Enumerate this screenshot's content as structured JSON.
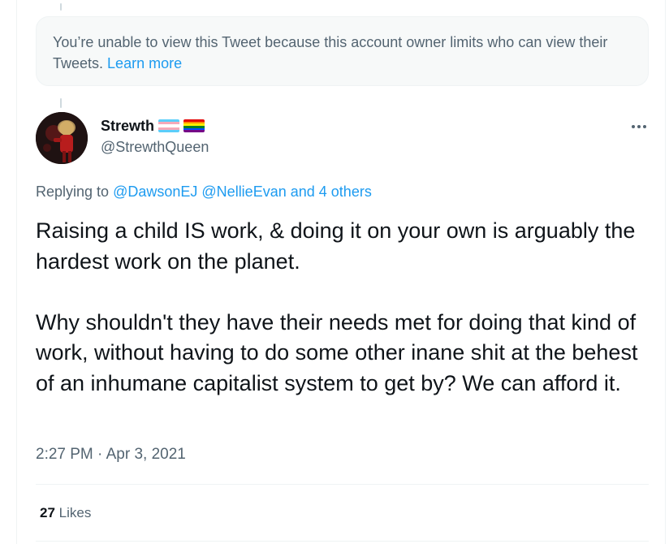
{
  "notice": {
    "text": "You’re unable to view this Tweet because this account owner limits who can view their Tweets.",
    "link": "Learn more"
  },
  "user": {
    "display_name": "Strewth",
    "handle": "@StrewthQueen",
    "flags": [
      "transgender-flag",
      "rainbow-pride-flag"
    ]
  },
  "reply": {
    "prefix": "Replying to",
    "mention1": "@DawsonEJ",
    "mention2": "@NellieEvan",
    "others": "and 4 others"
  },
  "tweet": {
    "paragraph1": "Raising a child IS work, & doing it on your own is arguably the hardest work on the planet.",
    "paragraph2": "Why shouldn't they have their needs met for doing that kind of work, without having to do some other inane shit at the behest of an inhumane capitalist system to get by? We can afford it.",
    "time": "2:27 PM",
    "separator": "·",
    "date": "Apr 3, 2021"
  },
  "stats": {
    "likes_count": "27",
    "likes_label": "Likes"
  },
  "colors": {
    "link": "#1d9bf0",
    "secondary_text": "#536471",
    "primary_text": "#0f1419"
  }
}
